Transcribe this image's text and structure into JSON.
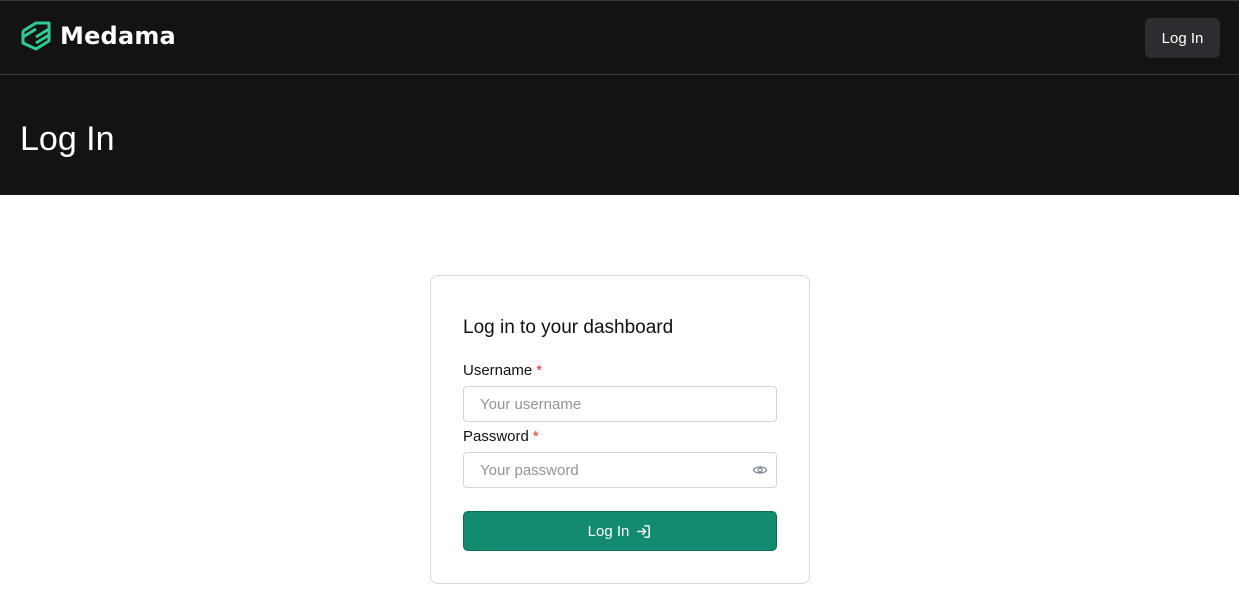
{
  "header": {
    "brand_name": "Medama",
    "brand_logo_icon": "medama-logo-icon",
    "brand_color": "#2ecc8f",
    "nav_login_label": "Log In"
  },
  "hero": {
    "title": "Log In"
  },
  "login_card": {
    "title": "Log in to your dashboard",
    "username": {
      "label": "Username",
      "required_marker": "*",
      "placeholder": "Your username",
      "value": ""
    },
    "password": {
      "label": "Password",
      "required_marker": "*",
      "placeholder": "Your password",
      "value": "",
      "toggle_icon": "eye-icon"
    },
    "submit": {
      "label": "Log In",
      "icon": "login-arrow-icon",
      "color": "#128b6e"
    }
  }
}
